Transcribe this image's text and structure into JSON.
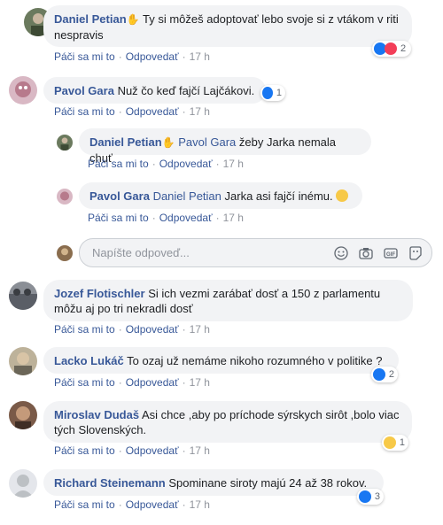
{
  "actions": {
    "like": "Páči sa mi to",
    "reply": "Odpovedať",
    "time": "17 h"
  },
  "comments": [
    {
      "author": "Daniel Petian",
      "text": "Ty si môžeš adoptovať lebo svoje si z vtákom v riti nespravis",
      "reactions": "2"
    },
    {
      "author": "Pavol Gara",
      "text": "Nuž čo keď fajčí Lajčákovi.",
      "reactions": "1"
    },
    {
      "author": "Jozef Flotischler",
      "text": "Si ich vezmi zarábať dosť a 150 z parlamentu môžu aj po tri nekradli dosť",
      "reactions": ""
    },
    {
      "author": "Lacko Lukáč",
      "text": "To ozaj už nemáme nikoho rozumného v politike ?",
      "reactions": "2"
    },
    {
      "author": "Miroslav Dudaš",
      "text": "Asi chce ,aby po príchode sýrskych sirôt ,bolo viac tých Slovenských.",
      "reactions": "1"
    },
    {
      "author": "Richard Steinemann",
      "text": "Spominane siroty majú 24 až 38 rokov.",
      "reactions": "3"
    }
  ],
  "replies": [
    {
      "author": "Daniel Petian",
      "mention": "Pavol Gara",
      "text": "žeby Jarka nemala chuť"
    },
    {
      "author": "Pavol Gara",
      "mention": "Daniel Petian",
      "text": "Jarka asi fajčí inému."
    }
  ],
  "reply_box": {
    "placeholder": "Napíšte odpoveď..."
  },
  "icons": [
    "emoji-icon",
    "camera-icon",
    "gif-icon",
    "sticker-icon"
  ],
  "colors": {
    "link": "#385898",
    "bubble": "#f2f3f5",
    "like": "#1877f2",
    "love": "#f33e58"
  }
}
